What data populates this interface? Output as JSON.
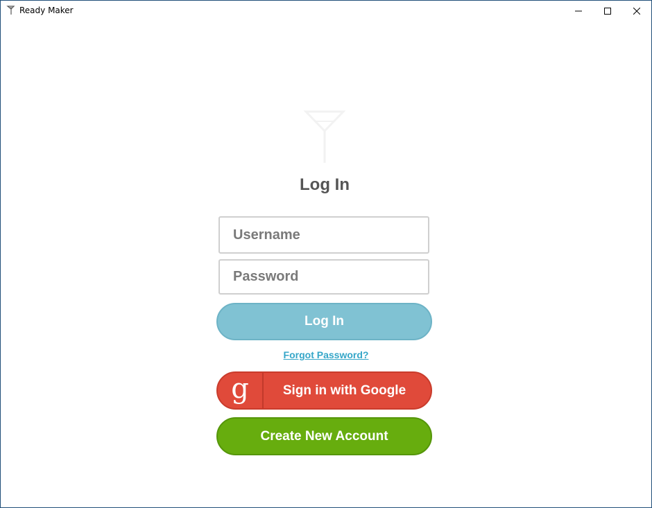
{
  "window": {
    "title": "Ready Maker",
    "app_icon": "ready-maker-icon",
    "controls": [
      "minimize-icon",
      "maximize-icon",
      "close-icon"
    ]
  },
  "login": {
    "heading": "Log In",
    "username_placeholder": "Username",
    "password_placeholder": "Password",
    "login_button": "Log In",
    "forgot_password": "Forgot Password?",
    "google_glyph": "g",
    "google_button": "Sign in with Google",
    "create_account_button": "Create New Account"
  },
  "colors": {
    "login_button": "#80c2d3",
    "google_button": "#e04a3a",
    "create_button": "#67ad0e",
    "link": "#35a6c8",
    "heading": "#555555"
  }
}
